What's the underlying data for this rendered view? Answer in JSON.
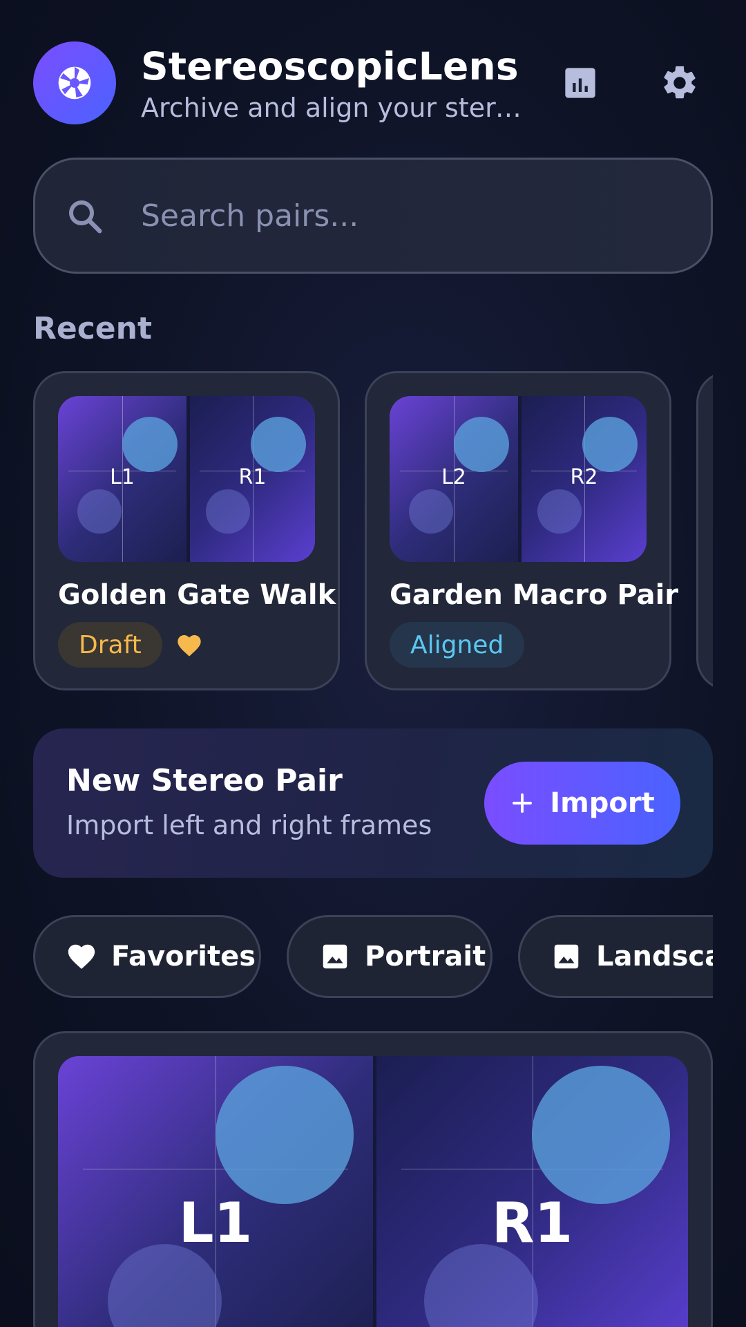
{
  "app": {
    "title": "StereoscopicLens",
    "subtitle": "Archive and align your stereo pairs",
    "logo_icon": "aperture-icon",
    "stats_icon": "bar-chart-icon",
    "settings_icon": "gear-icon"
  },
  "search": {
    "placeholder": "Search pairs...",
    "value": ""
  },
  "recent": {
    "title": "Recent",
    "cards": [
      {
        "title": "Golden Gate Walk",
        "left_label": "L1",
        "right_label": "R1",
        "status": "Draft",
        "favorite": true
      },
      {
        "title": "Garden Macro Pair",
        "left_label": "L2",
        "right_label": "R2",
        "status": "Aligned",
        "favorite": false
      }
    ]
  },
  "new_pair": {
    "title": "New Stereo Pair",
    "subtitle": "Import left and right frames",
    "button_label": "Import"
  },
  "filters": [
    {
      "label": "Favorites",
      "icon": "heart-icon"
    },
    {
      "label": "Portrait",
      "icon": "image-icon"
    },
    {
      "label": "Landscape",
      "icon": "image-icon"
    }
  ],
  "featured": {
    "left_label": "L1",
    "right_label": "R1"
  },
  "colors": {
    "accent_start": "#7a4dff",
    "accent_end": "#4a63ff",
    "draft": "#f5b94d",
    "aligned": "#5cc8f2",
    "favorite": "#f5b94d"
  }
}
